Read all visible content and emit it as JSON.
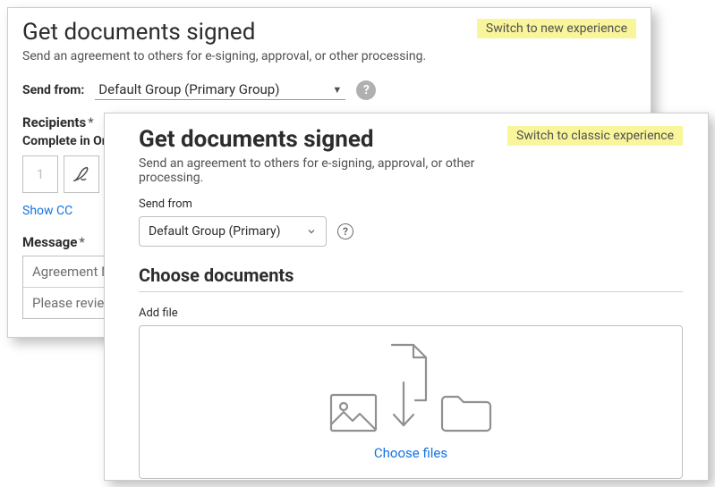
{
  "classic": {
    "title": "Get documents signed",
    "subtitle": "Send an agreement to others for e-signing, approval, or other processing.",
    "switch_label": "Switch to new experience",
    "send_from_label": "Send from:",
    "send_from_value": "Default Group (Primary Group)",
    "recipients_label": "Recipients",
    "complete_order_label": "Complete in Ord",
    "order_number": "1",
    "show_cc": "Show CC",
    "message_label": "Message",
    "agreement_placeholder": "Agreement N",
    "review_placeholder": "Please review a"
  },
  "newexp": {
    "title": "Get documents signed",
    "subtitle": "Send an agreement to others for e-signing, approval, or other processing.",
    "switch_label": "Switch to classic experience",
    "send_from_label": "Send from",
    "send_from_value": "Default Group (Primary)",
    "choose_documents": "Choose documents",
    "add_file_label": "Add file",
    "choose_files": "Choose files"
  }
}
